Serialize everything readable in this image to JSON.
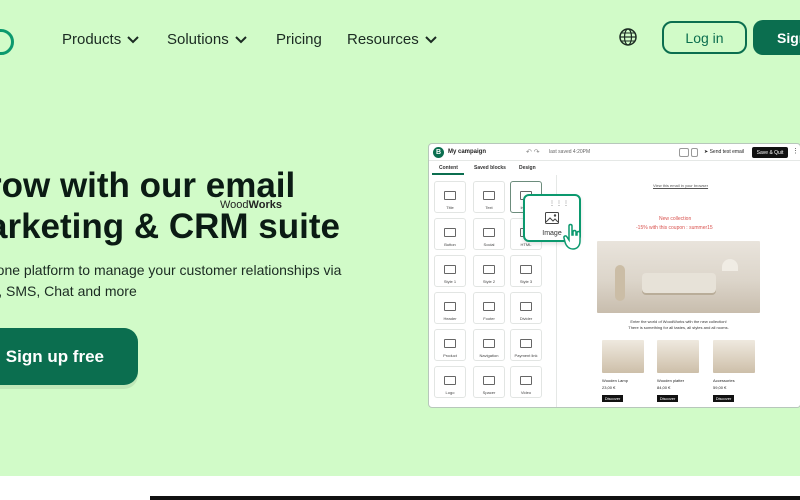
{
  "nav": {
    "items": [
      {
        "label": "Products",
        "dropdown": true
      },
      {
        "label": "Solutions",
        "dropdown": true
      },
      {
        "label": "Pricing",
        "dropdown": false
      },
      {
        "label": "Resources",
        "dropdown": true
      }
    ],
    "login_label": "Log in",
    "signup_label": "Sign"
  },
  "hero": {
    "headline_line1": "row with our email",
    "headline_line2": "arketing & CRM suite",
    "sub_line1": "-one platform to manage your customer relationships via",
    "sub_line2": "il, SMS, Chat and more",
    "cta_label": "Sign up free"
  },
  "editor": {
    "logo_letter": "B",
    "campaign_title": "My campaign",
    "saved_text": "last saved 4:20PM",
    "send_test_label": "Send test email",
    "save_quit_label": "Save & Quit",
    "tabs": [
      "Content",
      "Saved blocks",
      "Design"
    ],
    "blocks": [
      "Title",
      "Text",
      "Image",
      "Button",
      "Social",
      "HTML",
      "Style 1",
      "Style 2",
      "Style 3",
      "Header",
      "Footer",
      "Divider",
      "Product",
      "Navigation",
      "Payment link",
      "Logo",
      "Spacer",
      "Video"
    ],
    "drag_label": "Image",
    "email": {
      "view_link": "View this email in your browser",
      "brand_light": "Wood",
      "brand_bold": "Works",
      "new_collection": "New collection",
      "coupon": "-15% with this coupon : summer15",
      "enter_line1": "Enter the world of WoodWorks with the new collection!",
      "enter_line2": "There is something for all tastes, all styles and all rooms.",
      "products": [
        {
          "name": "Wooden Lamp",
          "price": "23,00 €",
          "button": "Discover"
        },
        {
          "name": "Wooden platter",
          "price": "84,00 €",
          "button": "Discover"
        },
        {
          "name": "Accessories",
          "price": "59,00 €",
          "button": "Discover"
        }
      ]
    }
  },
  "colors": {
    "background": "#d1fbc8",
    "brand_green": "#0b6e4f",
    "accent_green": "#0b996e",
    "coupon_red": "#d9534f"
  },
  "icons": [
    "globe-icon",
    "chevron-down-icon",
    "image-icon",
    "hand-cursor-icon"
  ]
}
